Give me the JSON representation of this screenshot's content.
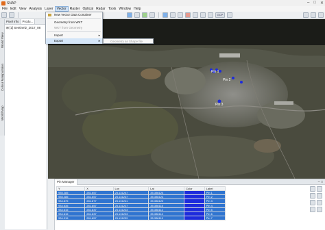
{
  "window": {
    "title": "SNAP"
  },
  "menu": {
    "items": [
      {
        "label": "File"
      },
      {
        "label": "Edit"
      },
      {
        "label": "View"
      },
      {
        "label": "Analysis"
      },
      {
        "label": "Layer"
      },
      {
        "label": "Vector"
      },
      {
        "label": "Raster"
      },
      {
        "label": "Optical"
      },
      {
        "label": "Radar"
      },
      {
        "label": "Tools"
      },
      {
        "label": "Window"
      },
      {
        "label": "Help"
      }
    ]
  },
  "vector_menu": {
    "items": [
      {
        "label": "New Vector Data Container",
        "enabled": true
      },
      {
        "label": "Geometry from WKT",
        "enabled": true
      },
      {
        "label": "WKT from Geometry",
        "enabled": false
      },
      {
        "label": "Import",
        "enabled": true,
        "submenu": true
      },
      {
        "label": "Export",
        "enabled": true,
        "submenu": true
      }
    ],
    "export_submenu": [
      {
        "label": "Geometry as Shape file",
        "enabled": false
      }
    ]
  },
  "toolbar": {
    "gcp_label": "GCP"
  },
  "left_strip": {
    "tabs": [
      "World View",
      "Colour Manipulation",
      "World Map"
    ]
  },
  "left_panel": {
    "tabs": [
      "Pixel Info",
      "Produ..."
    ],
    "tree_item": "[1] Sentinel2_2017_08"
  },
  "map": {
    "labels": [
      "Pin 1",
      "Pin 2",
      "Pin 3"
    ]
  },
  "pin_manager": {
    "title": "Pin Manager",
    "columns": [
      "Y",
      "X",
      "Lon",
      "Lat",
      "Color",
      "Label"
    ],
    "rows": [
      {
        "y": "935.285",
        "x": "281.657",
        "lon": "25.131247",
        "lat": "35.336124",
        "label": "Pin 1"
      },
      {
        "y": "935.285",
        "x": "281.657",
        "lon": "25.131247",
        "lat": "35.336124",
        "label": "Pin 2"
      },
      {
        "y": "934.875",
        "x": "281.877",
        "lon": "25.131241",
        "lat": "35.336120",
        "label": "Pin 3"
      },
      {
        "y": "934.635",
        "x": "281.857",
        "lon": "25.131227",
        "lat": "35.336115",
        "label": "Pin 4"
      },
      {
        "y": "934.615",
        "x": "281.837",
        "lon": "25.131223",
        "lat": "35.336112",
        "label": "Pin 5"
      },
      {
        "y": "934.615",
        "x": "281.837",
        "lon": "25.131223",
        "lat": "35.336112",
        "label": "Pin 6"
      },
      {
        "y": "934.915",
        "x": "281.857",
        "lon": "25.131239",
        "lat": "35.336119",
        "label": "Pin 7"
      }
    ],
    "pin_color": "#1d2bdc"
  },
  "colors": {
    "selection": "#2f74d0",
    "menu_highlight": "#d5e6f8"
  }
}
